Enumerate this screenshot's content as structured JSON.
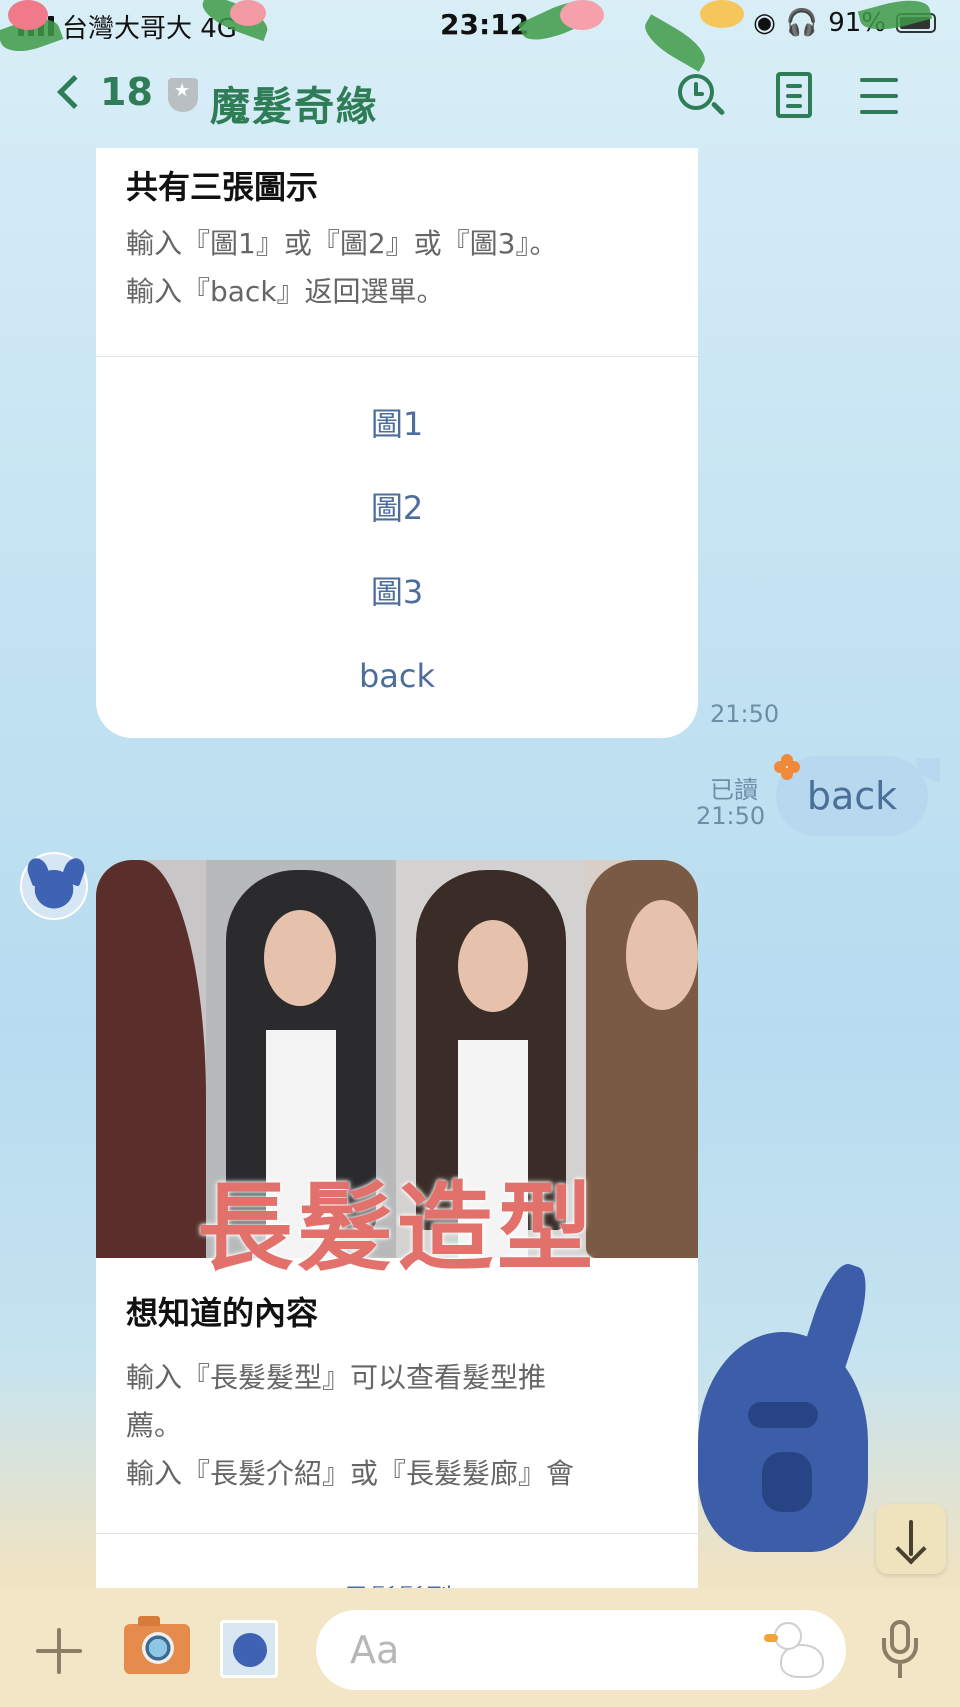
{
  "status_bar": {
    "carrier": "台灣大哥大  4G",
    "time": "23:12",
    "battery": "91%"
  },
  "header": {
    "back_count": "18",
    "title": "魔髮奇緣"
  },
  "card1": {
    "title": "共有三張圖示",
    "text": "輸入『圖1』或『圖2』或『圖3』。\n輸入『back』返回選單。",
    "actions": [
      "圖1",
      "圖2",
      "圖3",
      "back"
    ],
    "time": "21:50"
  },
  "my_message": {
    "read": "已讀",
    "time": "21:50",
    "text": "back"
  },
  "card2": {
    "image_caption": "長髮造型",
    "title": "想知道的內容",
    "text": "輸入『長髮髮型』可以查看髮型推\n薦。\n輸入『長髮介紹』或『長髮髮廊』會",
    "cut_action": "長髮髮型"
  },
  "input": {
    "placeholder": "Aa"
  },
  "icons": {
    "back": "chevron-left-icon",
    "verified": "shield-star-icon",
    "search": "search-icon",
    "notes": "notes-icon",
    "menu": "menu-icon",
    "plus": "plus-icon",
    "camera": "camera-icon",
    "sticker": "sticker-icon",
    "mic": "microphone-icon",
    "scroll": "arrow-down-icon"
  },
  "colors": {
    "accent": "#2e7d57",
    "link": "#4d6d9c",
    "my_bubble": "#b7d8ee",
    "bottom_bar": "#f3e6c6"
  }
}
